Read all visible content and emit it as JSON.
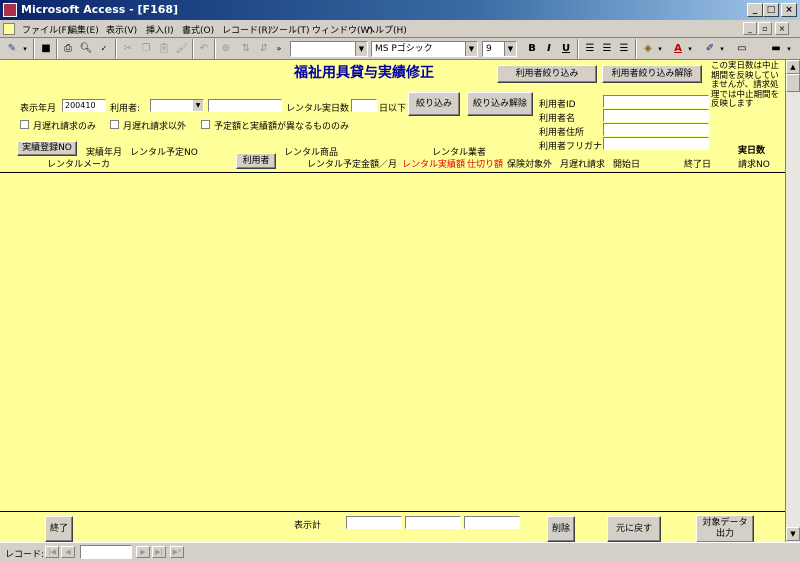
{
  "window": {
    "title": "Microsoft Access - [F168]",
    "min": "_",
    "max": "□",
    "close": "×",
    "child_min": "_",
    "child_restore": "▫",
    "child_close": "×"
  },
  "menu": [
    "ファイル(F)",
    "編集(E)",
    "表示(V)",
    "挿入(I)",
    "書式(O)",
    "レコード(R)",
    "ツール(T)",
    "ウィンドウ(W)",
    "ヘルプ(H)"
  ],
  "toolbar": {
    "font_name": "MS Pゴシック",
    "font_size": "9",
    "bold": "B",
    "italic": "I",
    "underline": "U",
    "font_color": "A"
  },
  "form": {
    "title": "福祉用具貸与実績修正",
    "btn_user_filter": "利用者絞り込み",
    "btn_user_filter_clear": "利用者絞り込み解除",
    "note": "この実日数は中止期間を反映していませんが、請求処理では中止期間を反映します",
    "display_month_label": "表示年月",
    "display_month_value": "200410",
    "user_label": "利用者:",
    "rental_days_label": "レンタル実日数",
    "days_below": "日以下",
    "btn_filter": "絞り込み",
    "btn_filter_clear": "絞り込み解除",
    "user_id_label": "利用者ID",
    "user_name_label": "利用者名",
    "user_address_label": "利用者住所",
    "user_furigana_label": "利用者フリガナ",
    "chk_late_only": "月遅れ請求のみ",
    "chk_not_late": "月遅れ請求以外",
    "chk_diff": "予定額と実績額が異なるもののみ",
    "btn_record_no": "実績登録NO",
    "col_record_month": "実績年月",
    "col_rental_plan_no": "レンタル予定NO",
    "col_rental_item": "レンタル商品",
    "col_rental_vendor": "レンタル業者",
    "col_actual_days": "実日数",
    "col_maker": "レンタルメーカ",
    "btn_user": "利用者",
    "col_plan_amount": "レンタル予定金額／月",
    "col_actual_amount": "レンタル実績額",
    "col_cutoff": "仕切り額",
    "col_insurance_ex": "保険対象外",
    "col_late_claim": "月遅れ請求",
    "col_start": "開始日",
    "col_end": "終了日",
    "col_claim_no": "請求NO",
    "btn_close": "終了",
    "total_label": "表示計",
    "btn_delete": "削除",
    "btn_restore": "元に戻す",
    "btn_output": "対象データ\n出力"
  },
  "status": {
    "record_label": "レコード:"
  }
}
